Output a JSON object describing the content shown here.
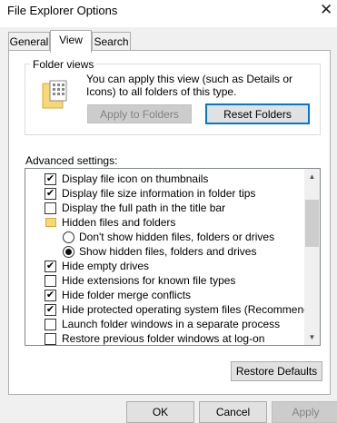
{
  "window": {
    "title": "File Explorer Options",
    "close_glyph": "✕"
  },
  "tabs": [
    {
      "label": "General",
      "active": false
    },
    {
      "label": "View",
      "active": true
    },
    {
      "label": "Search",
      "active": false
    }
  ],
  "folder_views": {
    "legend": "Folder views",
    "description": "You can apply this view (such as Details or Icons) to all folders of this type.",
    "apply_button": "Apply to Folders",
    "reset_button": "Reset Folders"
  },
  "advanced": {
    "label": "Advanced settings:",
    "items": [
      {
        "type": "checkbox",
        "checked": true,
        "label": "Display file icon on thumbnails"
      },
      {
        "type": "checkbox",
        "checked": true,
        "label": "Display file size information in folder tips"
      },
      {
        "type": "checkbox",
        "checked": false,
        "label": "Display the full path in the title bar"
      },
      {
        "type": "folder",
        "label": "Hidden files and folders"
      },
      {
        "type": "radio",
        "checked": false,
        "label": "Don't show hidden files, folders or drives"
      },
      {
        "type": "radio",
        "checked": true,
        "label": "Show hidden files, folders and drives"
      },
      {
        "type": "checkbox",
        "checked": true,
        "label": "Hide empty drives"
      },
      {
        "type": "checkbox",
        "checked": false,
        "label": "Hide extensions for known file types"
      },
      {
        "type": "checkbox",
        "checked": true,
        "label": "Hide folder merge conflicts"
      },
      {
        "type": "checkbox",
        "checked": true,
        "label": "Hide protected operating system files (Recommended)"
      },
      {
        "type": "checkbox",
        "checked": false,
        "label": "Launch folder windows in a separate process"
      },
      {
        "type": "checkbox",
        "checked": false,
        "label": "Restore previous folder windows at log-on"
      }
    ],
    "restore_defaults_button": "Restore Defaults"
  },
  "footer": {
    "ok": "OK",
    "cancel": "Cancel",
    "apply": "Apply"
  },
  "icons": {
    "check_glyph": "✔",
    "scroll_up": "▲",
    "scroll_down": "▼"
  }
}
